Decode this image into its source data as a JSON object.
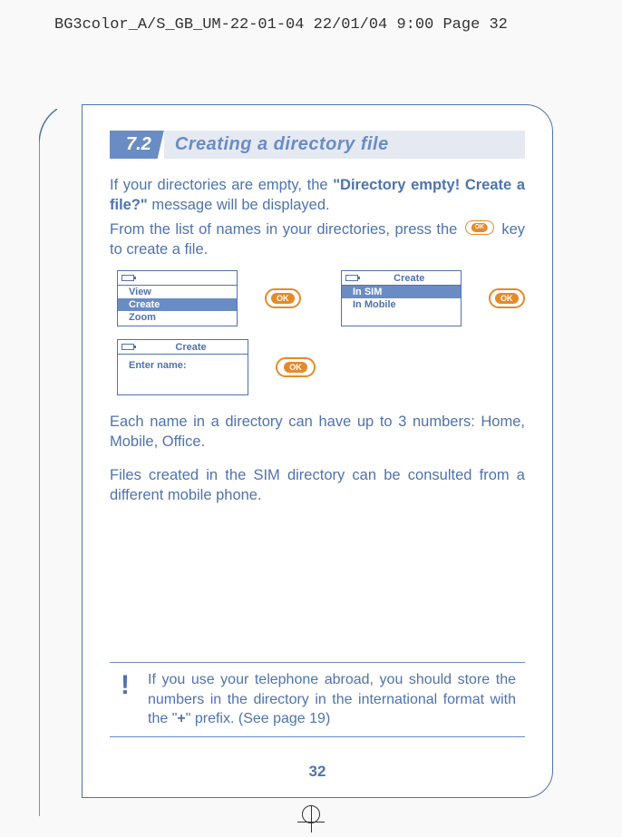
{
  "crop_header": "BG3color_A/S_GB_UM-22-01-04  22/01/04  9:00  Page 32",
  "section": {
    "num": "7.2",
    "title": "Creating a directory file"
  },
  "para1_a": "If your directories are empty, the ",
  "para1_b": "\"Directory empty! Create a file?\"",
  "para1_c": " message will be displayed.",
  "para2_a": "From the list of names in your directories, press the ",
  "para2_b": " key to create a file.",
  "screen1": {
    "row1": "View",
    "row2": "Create",
    "row3": "Zoom"
  },
  "screen2": {
    "title": "Create",
    "row1": "In SIM",
    "row2": "In Mobile"
  },
  "screen3": {
    "title": "Create",
    "row1": "Enter name:"
  },
  "ok_label": "OK",
  "para3": "Each name in a directory can have up to 3 numbers: Home, Mobile, Office.",
  "para4": "Files created in the SIM directory can be consulted from a different mobile phone.",
  "note_icon": "!",
  "note_a": "If you use your telephone abroad, you should store the numbers in the directory in the international format with the \"",
  "note_b": "+",
  "note_c": "\" prefix. (See page 19)",
  "page_number": "32"
}
